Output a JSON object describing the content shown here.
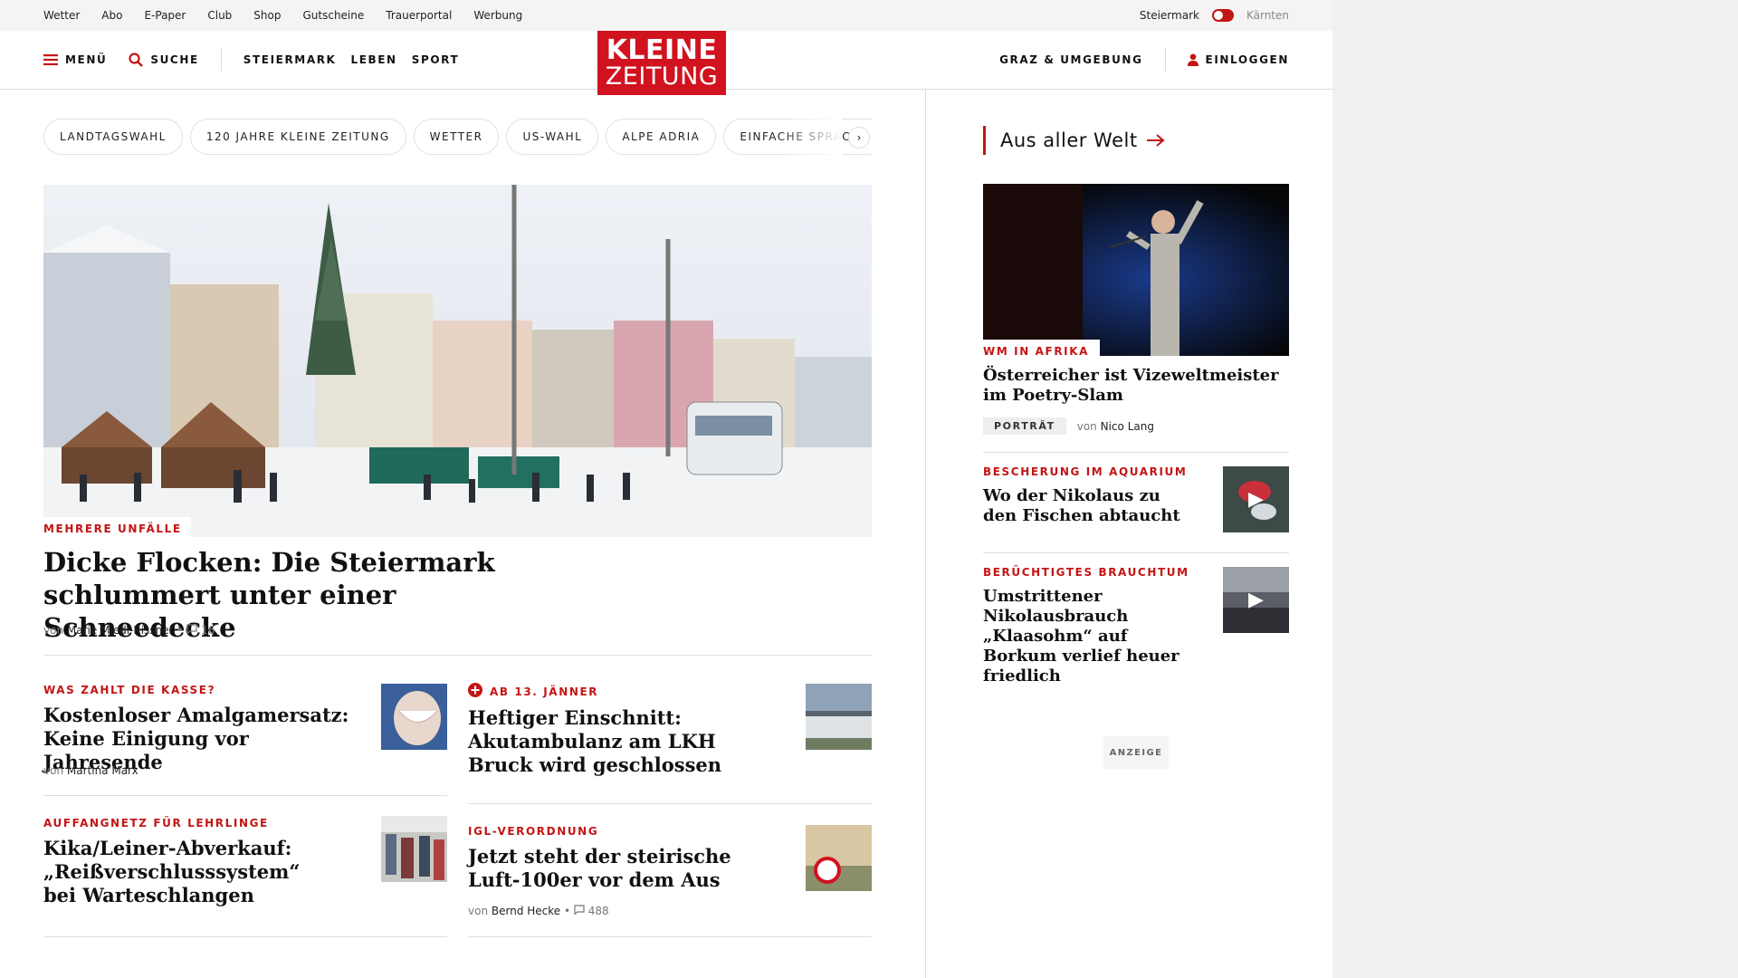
{
  "topbar": {
    "links": [
      "Wetter",
      "Abo",
      "E-Paper",
      "Club",
      "Shop",
      "Gutscheine",
      "Trauerportal",
      "Werbung"
    ],
    "region_active": "Steiermark",
    "region_inactive": "Kärnten"
  },
  "header": {
    "menu_label": "MENÜ",
    "search_label": "SUCHE",
    "categories": [
      "STEIERMARK",
      "LEBEN",
      "SPORT"
    ],
    "logo_line1": "KLEINE",
    "logo_line2": "ZEITUNG",
    "graz_label": "GRAZ & UMGEBUNG",
    "login_label": "EINLOGGEN"
  },
  "topics": [
    "LANDTAGSWAHL",
    "120 JAHRE KLEINE ZEITUNG",
    "WETTER",
    "US-WAHL",
    "ALPE ADRIA",
    "EINFACHE SPRACHE"
  ],
  "hero": {
    "kicker": "MEHRERE UNFÄLLE",
    "title": "Dicke Flocken: Die Steiermark schlummert unter einer Schneedecke",
    "by": "von",
    "author": "Marie Miedl-Rissner",
    "comments": "16"
  },
  "articles": [
    {
      "kicker": "WAS ZAHLT DIE KASSE?",
      "title": "Kostenloser Amalgamersatz: Keine Einigung vor Jahresende",
      "by": "von",
      "author": "Martina Marx"
    },
    {
      "kicker": "AB 13. JÄNNER",
      "title": "Heftiger Einschnitt: Akutambulanz am LKH Bruck wird geschlossen"
    },
    {
      "kicker": "AUFFANGNETZ FÜR LEHRLINGE",
      "title": "Kika/Leiner-Abverkauf: „Reißverschlusssystem“ bei Warteschlangen"
    },
    {
      "kicker": "IGL-VERORDNUNG",
      "title": "Jetzt steht der steirische Luft-100er vor dem Aus",
      "by": "von",
      "author": "Bernd Hecke",
      "comments": "488"
    }
  ],
  "sidebar": {
    "heading": "Aus aller Welt",
    "feature": {
      "kicker": "WM IN AFRIKA",
      "title": "Österreicher ist Vizeweltmeister im Poetry-Slam",
      "badge": "PORTRÄT",
      "by": "von",
      "author": "Nico Lang"
    },
    "items": [
      {
        "kicker": "BESCHERUNG IM AQUARIUM",
        "title": "Wo der Nikolaus zu den Fischen abtaucht"
      },
      {
        "kicker": "BERÜCHTIGTES BRAUCHTUM",
        "title": "Umstrittener Nikolausbrauch „Klaasohm“ auf Borkum verlief heuer friedlich"
      }
    ],
    "ad_label": "ANZEIGE"
  },
  "colors": {
    "accent": "#c41515",
    "logo_bg": "#d1121f"
  }
}
